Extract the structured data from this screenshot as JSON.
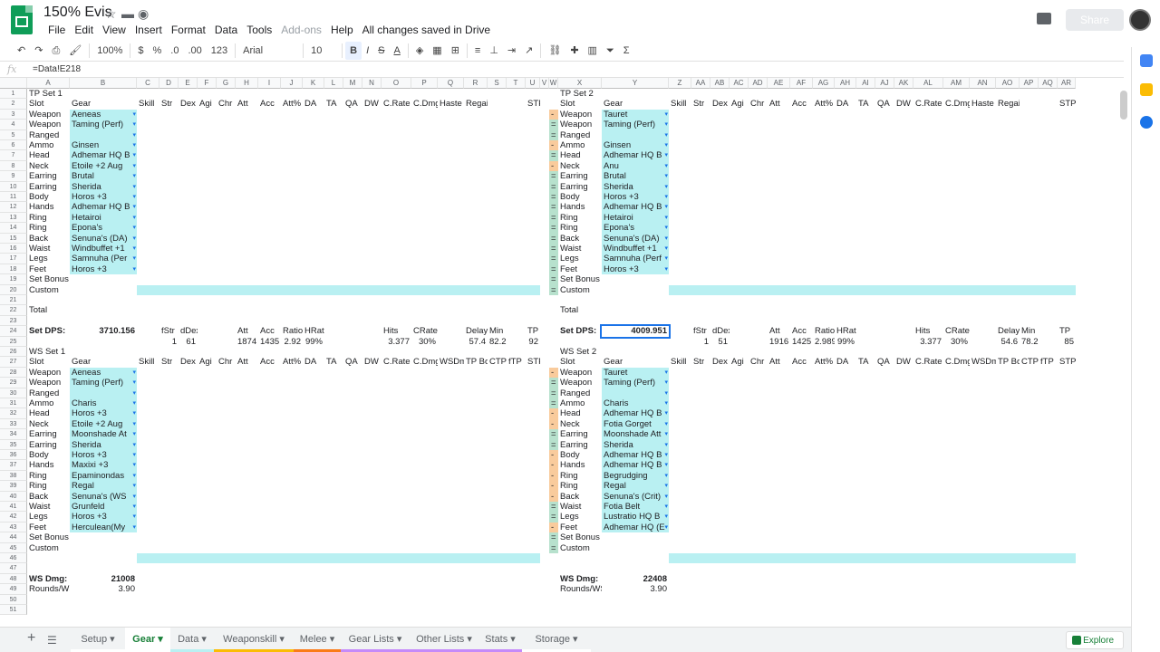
{
  "app": {
    "title": "150% Evis",
    "saved": "All changes saved in Drive",
    "share": "Share"
  },
  "menu": [
    "File",
    "Edit",
    "View",
    "Insert",
    "Format",
    "Data",
    "Tools",
    "Add-ons",
    "Help"
  ],
  "toolbar": {
    "zoom": "100%",
    "currency": "$",
    "percent": "%",
    "dec": ".0",
    "dec2": ".00",
    "fmt": "123",
    "font": "Arial",
    "size": "10",
    "bold": "B",
    "italic": "I",
    "strike": "S",
    "underline": "A",
    "sigma": "Σ"
  },
  "formula": {
    "label": "fx",
    "value": "=Data!E218"
  },
  "columns": [
    "A",
    "B",
    "C",
    "D",
    "E",
    "F",
    "G",
    "H",
    "I",
    "J",
    "K",
    "L",
    "M",
    "N",
    "O",
    "P",
    "Q",
    "R",
    "S",
    "T",
    "U",
    "V",
    "W",
    "X",
    "Y",
    "Z",
    "AA",
    "AB",
    "AC",
    "AD",
    "AE",
    "AF",
    "AG",
    "AH",
    "AI",
    "AJ",
    "AK",
    "AL",
    "AM",
    "AN",
    "AO",
    "AP",
    "AQ",
    "AR"
  ],
  "rows": [
    "1",
    "2",
    "3",
    "4",
    "5",
    "6",
    "7",
    "8",
    "9",
    "10",
    "11",
    "12",
    "13",
    "14",
    "15",
    "16",
    "17",
    "18",
    "19",
    "20",
    "21",
    "22",
    "23",
    "24",
    "25",
    "26",
    "27",
    "28",
    "29",
    "30",
    "31",
    "32",
    "33",
    "34",
    "35",
    "36",
    "37",
    "38",
    "39",
    "40",
    "41",
    "42",
    "43",
    "44",
    "45",
    "46",
    "47",
    "48",
    "49",
    "50",
    "51"
  ],
  "tabs": [
    {
      "label": "Setup",
      "color": "#ffffff"
    },
    {
      "label": "Gear",
      "color": "#ffffff"
    },
    {
      "label": "Data",
      "color": "#b9f0f2"
    },
    {
      "label": "Weaponskill",
      "color": "#fbbc04"
    },
    {
      "label": "Melee",
      "color": "#fa7b17"
    },
    {
      "label": "Gear Lists",
      "color": "#c58af9"
    },
    {
      "label": "Other Lists",
      "color": "#c58af9"
    },
    {
      "label": "Stats",
      "color": "#c58af9"
    },
    {
      "label": "Storage",
      "color": "#ffffff"
    }
  ],
  "explore": "Explore",
  "sheet": {
    "tp1": {
      "title": "TP Set 1",
      "hdr": [
        "Slot",
        "Gear",
        "Skill",
        "Str",
        "Dex",
        "Agi",
        "Chr",
        "Att",
        "Acc",
        "Att%",
        "DA",
        "TA",
        "QA",
        "DW",
        "C.Rate",
        "C.Dmg",
        "Haste",
        "Regain",
        "",
        "STP"
      ],
      "slots": [
        "Weapon",
        "Weapon",
        "Ranged",
        "Ammo",
        "Head",
        "Neck",
        "Earring",
        "Earring",
        "Body",
        "Hands",
        "Ring",
        "Ring",
        "Back",
        "Waist",
        "Legs",
        "Feet",
        "Set Bonus",
        "Custom"
      ],
      "gear": [
        "Aeneas",
        "Taming (Perf)",
        "",
        "Ginsen",
        "Adhemar HQ B",
        "Etoile +2 Aug",
        "Brutal",
        "Sherida",
        "Horos +3",
        "Adhemar HQ B",
        "Hetairoi",
        "Epona's",
        "Senuna's (DA)",
        "Windbuffet +1",
        "Samnuha (Per",
        "Horos +3",
        "",
        ""
      ],
      "total": "Total",
      "dps_label": "Set DPS:",
      "dps": "3710.156"
    },
    "tp2": {
      "title": "TP Set 2",
      "hdr": [
        "Slot",
        "Gear",
        "Skill",
        "Str",
        "Dex",
        "Agi",
        "Chr",
        "Att",
        "Acc",
        "Att%",
        "DA",
        "TA",
        "QA",
        "DW",
        "C.Rate",
        "C.Dmg",
        "Haste",
        "Regain",
        "STP"
      ],
      "slots": [
        "Weapon",
        "Weapon",
        "Ranged",
        "Ammo",
        "Head",
        "Neck",
        "Earring",
        "Earring",
        "Body",
        "Hands",
        "Ring",
        "Ring",
        "Back",
        "Waist",
        "Legs",
        "Feet",
        "Set Bonus",
        "Custom"
      ],
      "gear": [
        "Tauret",
        "Taming (Perf)",
        "",
        "Ginsen",
        "Adhemar HQ B",
        "Anu",
        "Brutal",
        "Sherida",
        "Horos +3",
        "Adhemar HQ B",
        "Hetairoi",
        "Epona's",
        "Senuna's (DA)",
        "Windbuffet +1",
        "Samnuha (Perf",
        "Horos +3",
        "",
        ""
      ],
      "total": "Total",
      "dps_label": "Set DPS:",
      "dps": "4009.951"
    },
    "ws1": {
      "title": "WS Set 1",
      "hdr": [
        "Slot",
        "Gear",
        "Skill",
        "Str",
        "Dex",
        "Agi",
        "Chr",
        "Att",
        "Acc",
        "Att%",
        "DA",
        "TA",
        "QA",
        "DW",
        "C.Rate",
        "C.Dmg",
        "WSDm",
        "TP Bo",
        "CTP",
        "fTP",
        "STP"
      ],
      "slots": [
        "Weapon",
        "Weapon",
        "Ranged",
        "Ammo",
        "Head",
        "Neck",
        "Earring",
        "Earring",
        "Body",
        "Hands",
        "Ring",
        "Ring",
        "Back",
        "Waist",
        "Legs",
        "Feet",
        "Set Bonus",
        "Custom"
      ],
      "gear": [
        "Aeneas",
        "Taming (Perf)",
        "",
        "Charis",
        "Horos +3",
        "Etoile +2 Aug",
        "Moonshade At",
        "Sherida",
        "Horos +3",
        "Maxixi +3",
        "Epaminondas",
        "Regal",
        "Senuna's (WS",
        "Grunfeld",
        "Horos +3",
        "Herculean(My",
        "",
        " "
      ],
      "dmg_label": "WS Dmg:",
      "dmg": "21008",
      "rounds_label": "Rounds/WS",
      "rounds": "3.90"
    },
    "ws2": {
      "title": "WS Set 2",
      "hdr": [
        "Slot",
        "Gear",
        "Skill",
        "Str",
        "Dex",
        "Agi",
        "Chr",
        "Att",
        "Acc",
        "Att%",
        "DA",
        "TA",
        "QA",
        "DW",
        "C.Rate",
        "C.Dmg",
        "WSDm",
        "TP Bo",
        "CTP",
        "fTP",
        "STP"
      ],
      "slots": [
        "Weapon",
        "Weapon",
        "Ranged",
        "Ammo",
        "Head",
        "Neck",
        "Earring",
        "Earring",
        "Body",
        "Hands",
        "Ring",
        "Ring",
        "Back",
        "Waist",
        "Legs",
        "Feet",
        "Set Bonus",
        "Custom"
      ],
      "gear": [
        "Tauret",
        "Taming (Perf)",
        "",
        "Charis",
        "Adhemar HQ B",
        "Fotia Gorget",
        "Moonshade Att",
        "Sherida",
        "Adhemar HQ B",
        "Adhemar HQ B",
        "Begrudging",
        "Regal",
        "Senuna's (Crit)",
        "Fotia Belt",
        "Lustratio HQ B",
        "Adhemar HQ (E",
        "",
        ""
      ],
      "dmg_label": "WS Dmg:",
      "dmg": "22408",
      "rounds_label": "Rounds/WS",
      "rounds": "3.90"
    },
    "misc": {
      "r24a": [
        "fStr",
        "dDex",
        "",
        "",
        "Att",
        "Acc",
        "Ratio",
        "HRate",
        "",
        "",
        "",
        "Hits",
        "CRate",
        "",
        "Delay",
        "Min",
        "",
        "TP"
      ],
      "r25a": [
        "1",
        "61",
        "",
        "",
        "1874",
        "1435",
        "2.92",
        "99%",
        "",
        "",
        "",
        "3.377",
        "30%",
        "",
        "57.4",
        "82.2",
        "",
        "92"
      ],
      "r24b": [
        "fStr",
        "dDex",
        "",
        "",
        "Att",
        "Acc",
        "Ratio",
        "HRate",
        "",
        "",
        "",
        "Hits",
        "CRate",
        "",
        "Delay",
        "Min",
        "",
        "TP"
      ],
      "r25b": [
        "1",
        "51",
        "",
        "",
        "1916",
        "1425",
        "2.989",
        "99%",
        "",
        "",
        "",
        "3.377",
        "30%",
        "",
        "54.6",
        "78.2",
        "",
        "85"
      ]
    }
  }
}
